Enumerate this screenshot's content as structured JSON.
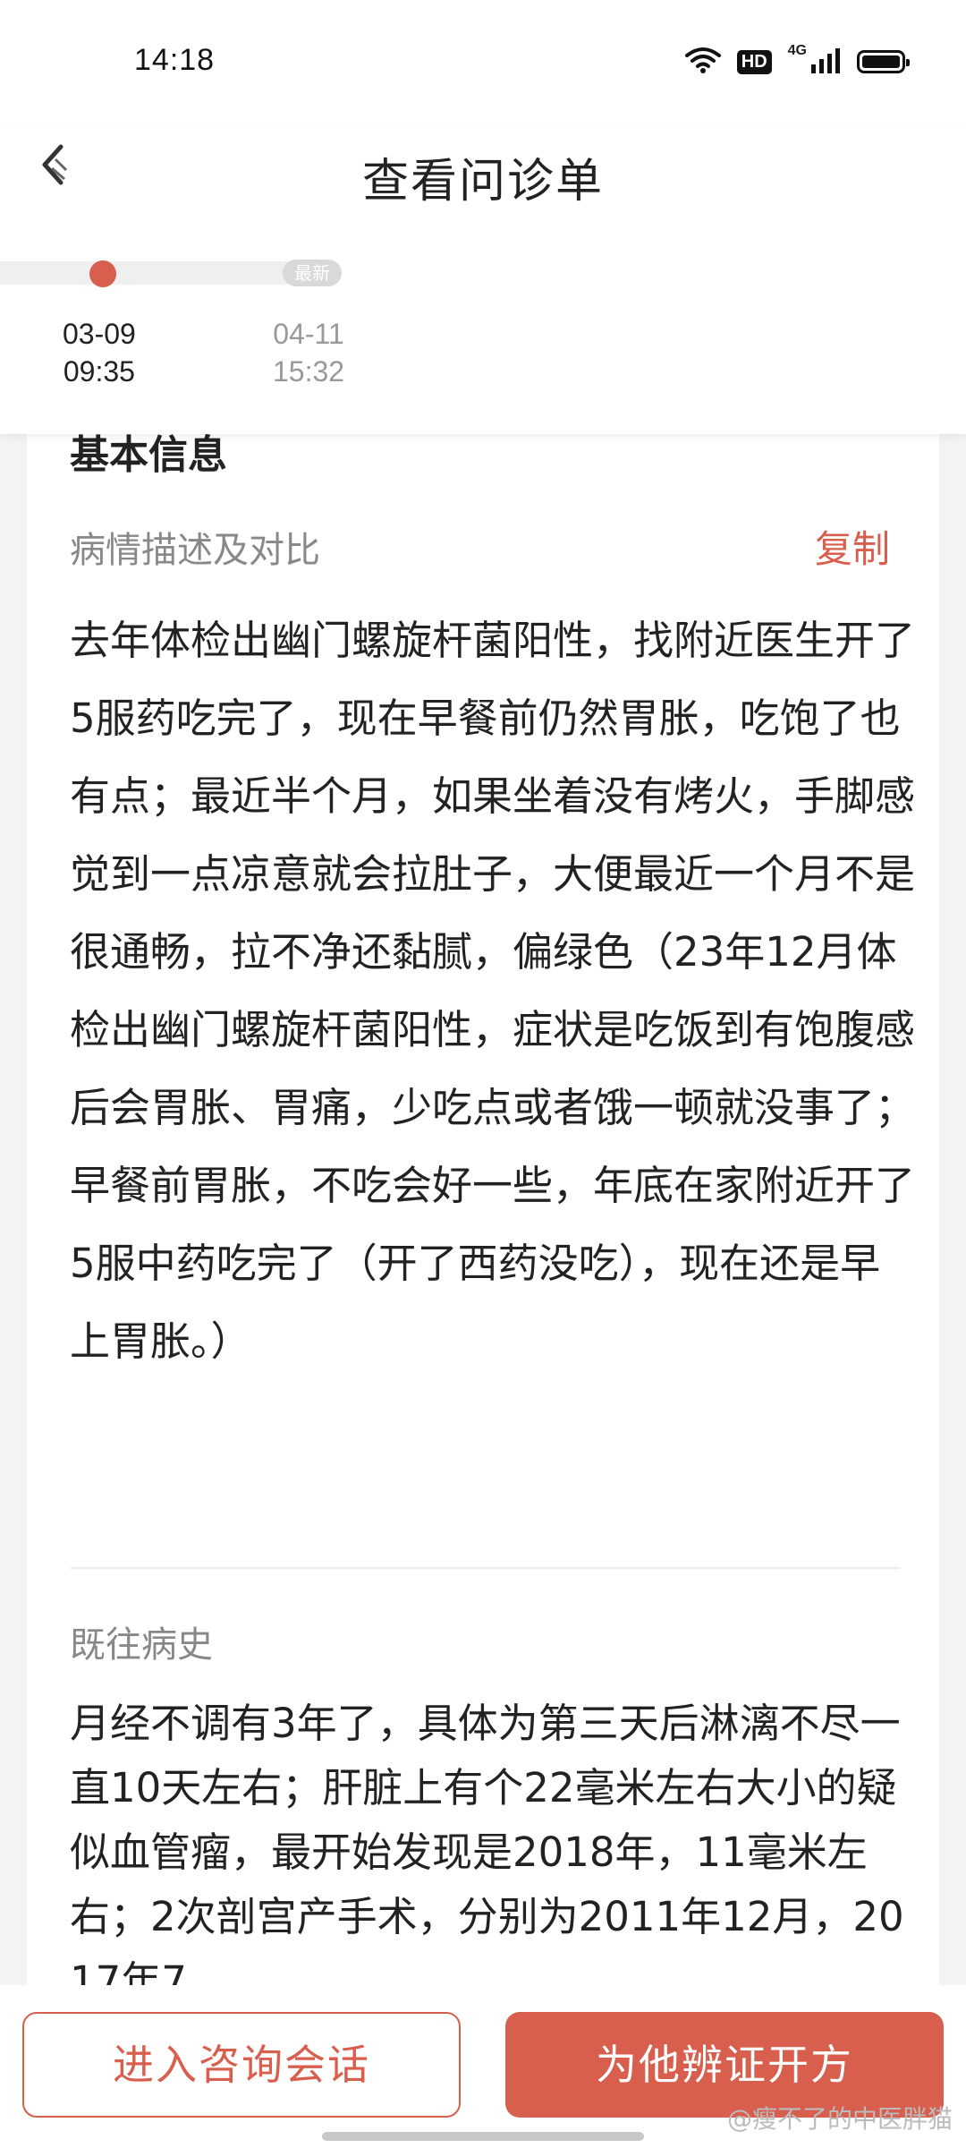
{
  "status_bar": {
    "time": "14:18",
    "icons": [
      "wifi-icon",
      "hd-icon",
      "signal-4g-icon",
      "battery-icon"
    ],
    "hd_label": "HD",
    "network_label": "4G"
  },
  "header": {
    "title": "查看问诊单",
    "back_icon": "back-icon",
    "timeline": {
      "latest_badge": "最新",
      "visits": [
        {
          "date": "03-09",
          "time": "09:35",
          "selected": true
        },
        {
          "date": "04-11",
          "time": "15:32",
          "selected": false
        }
      ]
    }
  },
  "card": {
    "section_title": "基本信息",
    "description": {
      "label": "病情描述及对比",
      "copy_label": "复制",
      "text": "去年体检出幽门螺旋杆菌阳性，找附近医生开了5服药吃完了，现在早餐前仍然胃胀，吃饱了也有点；最近半个月，如果坐着没有烤火，手脚感觉到一点凉意就会拉肚子，大便最近一个月不是很通畅，拉不净还黏腻，偏绿色（23年12月体检出幽门螺旋杆菌阳性，症状是吃饭到有饱腹感后会胃胀、胃痛，少吃点或者饿一顿就没事了；早餐前胃胀，不吃会好一些，年底在家附近开了5服中药吃完了（开了西药没吃），现在还是早上胃胀。）"
    },
    "history": {
      "label": "既往病史",
      "text": "月经不调有3年了，具体为第三天后淋漓不尽一直10天左右；肝脏上有个22毫米左右大小的疑似血管瘤，最开始发现是2018年，11毫米左右；2次剖宫产手术，分别为2011年12月，2017年7"
    }
  },
  "actions": {
    "consult_label": "进入咨询会话",
    "prescribe_label": "为他辨证开方"
  },
  "watermark": "@瘦不了的中医胖猫",
  "colors": {
    "accent": "#d85f4d",
    "muted_text": "#888888",
    "body_text": "#222222"
  }
}
